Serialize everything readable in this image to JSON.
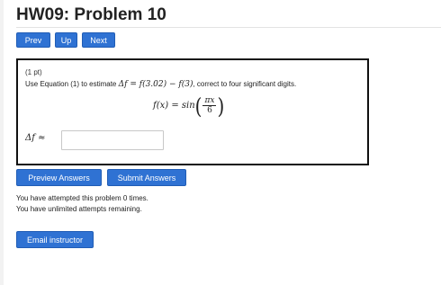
{
  "page": {
    "title": "HW09: Problem 10"
  },
  "nav": {
    "prev_label": "Prev",
    "up_label": "Up",
    "next_label": "Next"
  },
  "problem": {
    "points": "(1 pt)",
    "statement_prefix": "Use Equation (1) to estimate",
    "statement_expr_delta": "Δf",
    "statement_expr_rest": " = f(3.02) − f(3)",
    "statement_suffix": ", correct to four significant digits.",
    "formula_lhs": "f(x) = sin",
    "formula_num": "πx",
    "formula_den": "6",
    "answer_label": "Δf ≈",
    "answer_value": ""
  },
  "actions": {
    "preview_label": "Preview Answers",
    "submit_label": "Submit Answers"
  },
  "status": {
    "attempts": "You have attempted this problem 0 times.",
    "remaining": "You have unlimited attempts remaining."
  },
  "footer": {
    "email_label": "Email instructor"
  },
  "colors": {
    "button_bg": "#2f72d3",
    "button_text": "#ffffff",
    "box_border": "#111111"
  }
}
